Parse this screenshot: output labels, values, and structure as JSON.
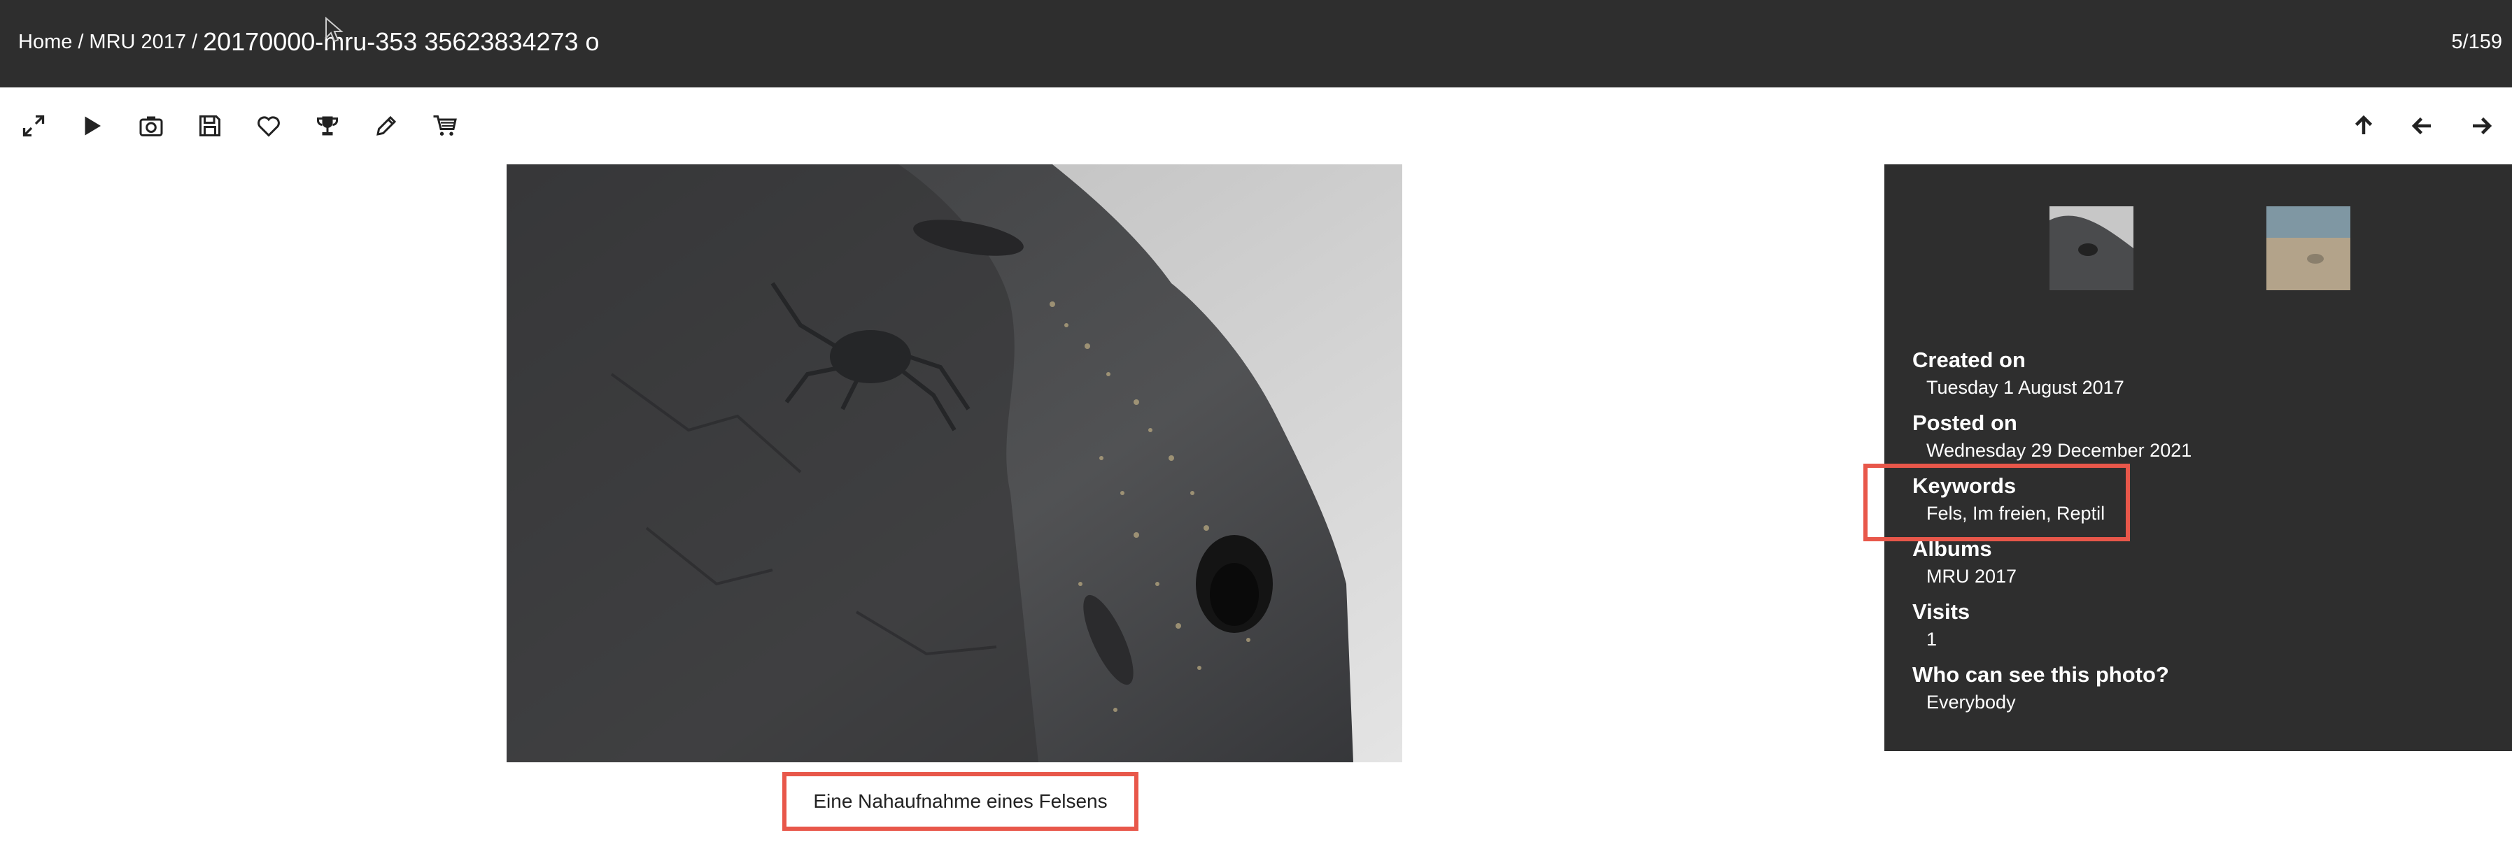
{
  "breadcrumb": {
    "home": "Home",
    "separator": "/",
    "album": "MRU 2017",
    "title": "20170000-mru-353 35623834273 o"
  },
  "counter": "5/159",
  "toolbar": {
    "left_icons": [
      "fullscreen-icon",
      "play-icon",
      "camera-icon",
      "save-icon",
      "heart-icon",
      "trophy-icon",
      "pencil-icon",
      "cart-icon"
    ],
    "right_icons": [
      "arrow-up-icon",
      "arrow-left-icon",
      "arrow-right-icon"
    ]
  },
  "caption": "Eine Nahaufnahme eines Felsens",
  "info": {
    "created_label": "Created on",
    "created_value": "Tuesday 1 August 2017",
    "posted_label": "Posted on",
    "posted_value": "Wednesday 29 December 2021",
    "keywords_label": "Keywords",
    "keywords_value": "Fels, Im freien, Reptil",
    "albums_label": "Albums",
    "albums_value": "MRU 2017",
    "visits_label": "Visits",
    "visits_value": "1",
    "who_label": "Who can see this photo?",
    "who_value": "Everybody"
  },
  "colors": {
    "header_bg": "#2e2e2e",
    "panel_bg": "#2e2e2e",
    "highlight": "#e8574a"
  }
}
